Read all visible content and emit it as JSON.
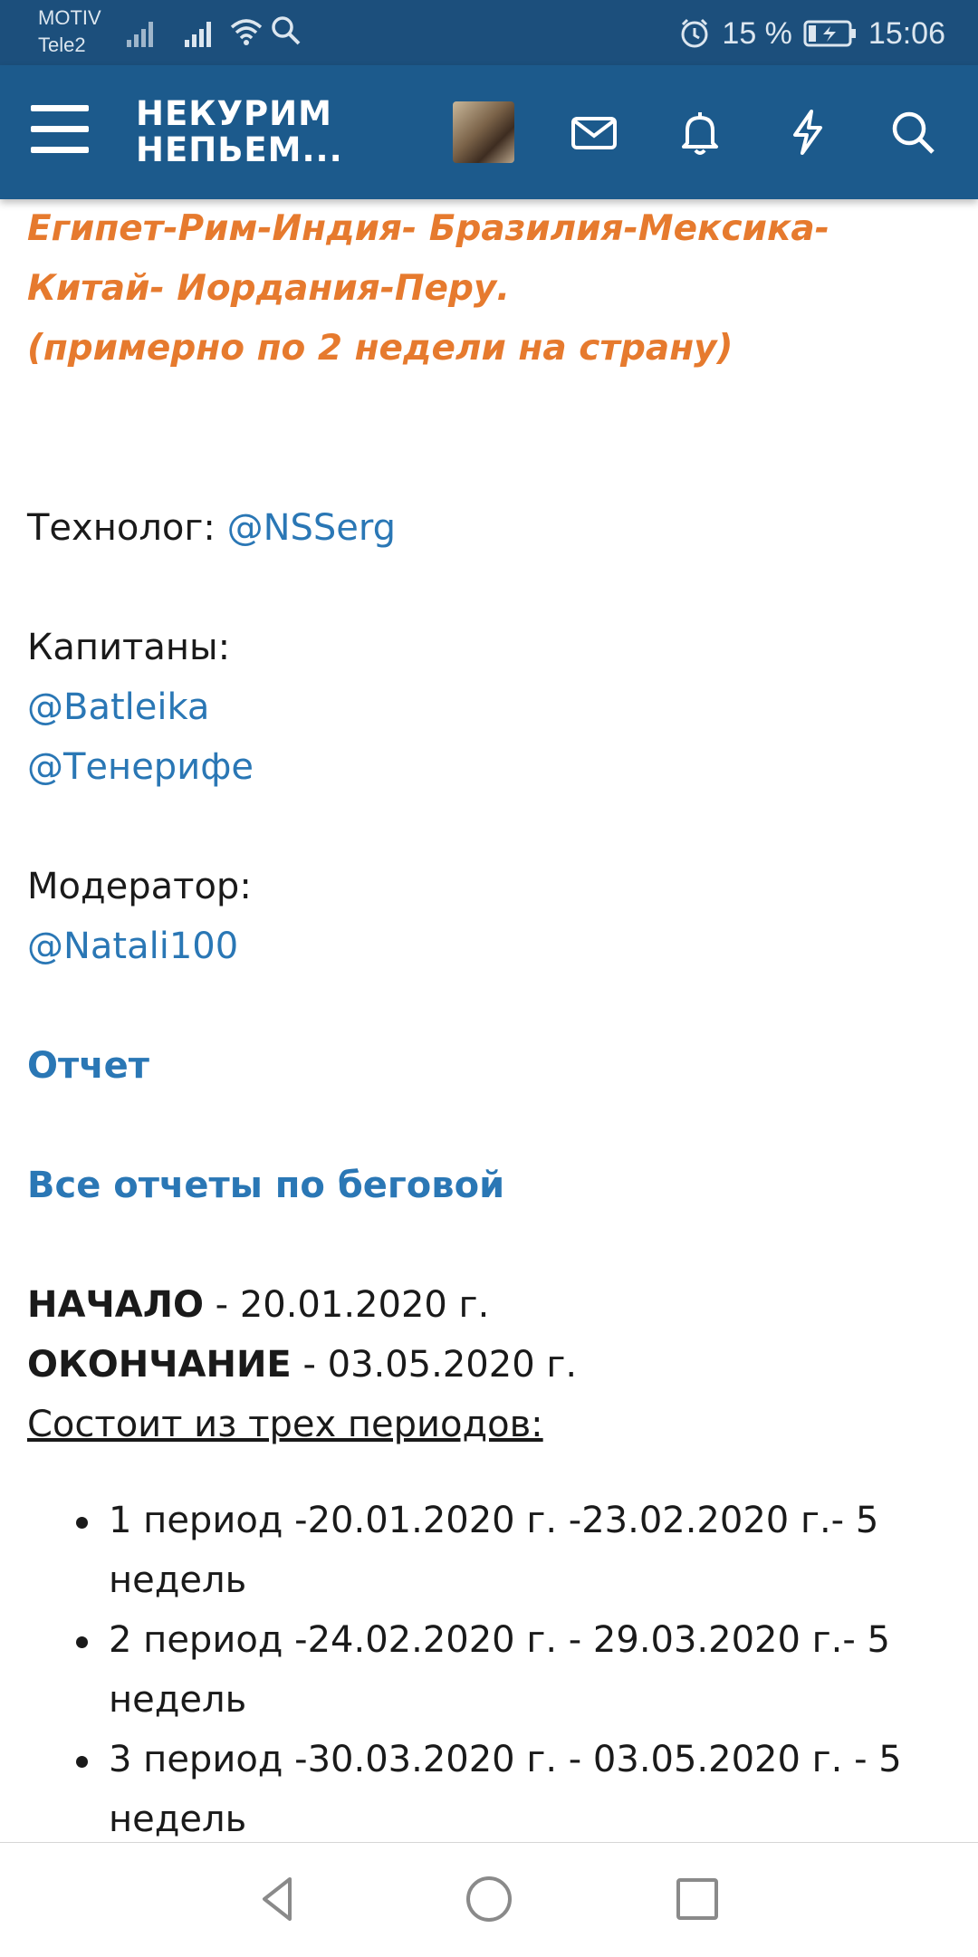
{
  "status_bar": {
    "carrier_1": "MOTIV",
    "carrier_2": "Tele2",
    "battery": "15 %",
    "time": "15:06"
  },
  "header": {
    "logo_line1": "НЕКУРИМ",
    "logo_line2": "НЕПЬЕМ...",
    "icons": [
      "menu-icon",
      "avatar",
      "mail-icon",
      "bell-icon",
      "lightning-icon",
      "search-icon"
    ]
  },
  "post": {
    "route_line1": "Египет-Рим-Индия- Бразилия-Мексика-",
    "route_line2": "Китай- Иордания-Перу.",
    "route_line3": "(примерно по 2 недели на страну)",
    "technolog_label": "Технолог: ",
    "technolog_link": "@NSSerg",
    "captains_label": "Капитаны:",
    "captain_1": "@Batleika",
    "captain_2": "@Тенерифе",
    "moderator_label": "Модератор:",
    "moderator_link": "@Natali100",
    "report_link": "Отчет",
    "all_reports_link": "Все отчеты по беговой",
    "start_label": "НАЧАЛО",
    "start_value": " - 20.01.2020 г.",
    "end_label": "ОКОНЧАНИЕ",
    "end_value": " - 03.05.2020 г.",
    "periods_heading": "Состоит из трех периодов:",
    "periods": [
      "1 период -20.01.2020 г. -23.02.2020 г.- 5 недель",
      "2 период -24.02.2020 г. - 29.03.2020 г.- 5 недель",
      "3 период -30.03.2020 г. - 03.05.2020 г. - 5 недель"
    ]
  },
  "colors": {
    "header_bg": "#1c5a8c",
    "status_bg": "#1c4f7c",
    "orange_text": "#e67a2e",
    "link": "#2a77b5"
  }
}
